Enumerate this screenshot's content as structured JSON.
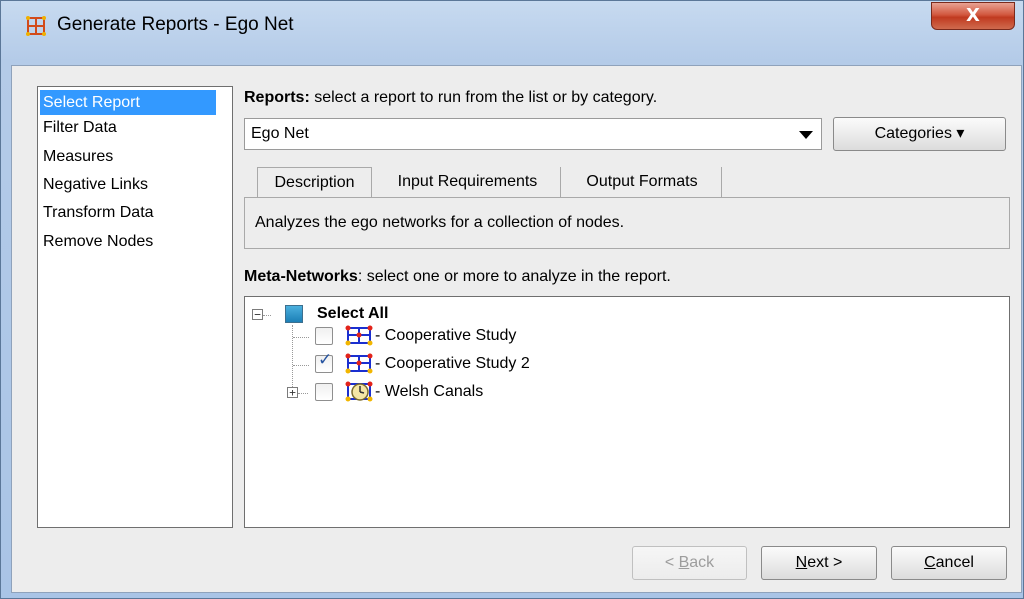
{
  "window": {
    "title": "Generate Reports - Ego Net",
    "close_label": "X"
  },
  "nav": {
    "items": [
      "Select Report",
      "Filter Data",
      "Measures",
      "Negative Links",
      "Transform Data",
      "Remove Nodes"
    ],
    "selected": "Select Report"
  },
  "reports": {
    "label_bold": "Reports:",
    "label_rest": " select a report to run from the list or by category.",
    "selected_value": "Ego Net",
    "categories_label": "Categories ▾"
  },
  "tabs": {
    "items": [
      "Description",
      "Input Requirements",
      "Output Formats"
    ],
    "active": "Description",
    "description_text": "Analyzes the ego networks for a collection of nodes."
  },
  "meta_networks": {
    "label_bold": "Meta-Networks",
    "label_rest": ": select one or more to analyze in the report.",
    "select_all_label": "Select All",
    "items": [
      {
        "label": "- Cooperative Study",
        "checked": false
      },
      {
        "label": "- Cooperative Study 2",
        "checked": true
      },
      {
        "label": "- Welsh Canals",
        "checked": false
      }
    ]
  },
  "buttons": {
    "back_prefix": "< ",
    "back_mnemonic": "B",
    "back_rest": "ack",
    "next_mnemonic": "N",
    "next_rest": "ext >",
    "cancel_mnemonic": "C",
    "cancel_rest": "ancel"
  },
  "colors": {
    "selection": "#3399ff",
    "title_gradient_top": "#c7daf0",
    "close_button": "#c8482e"
  }
}
